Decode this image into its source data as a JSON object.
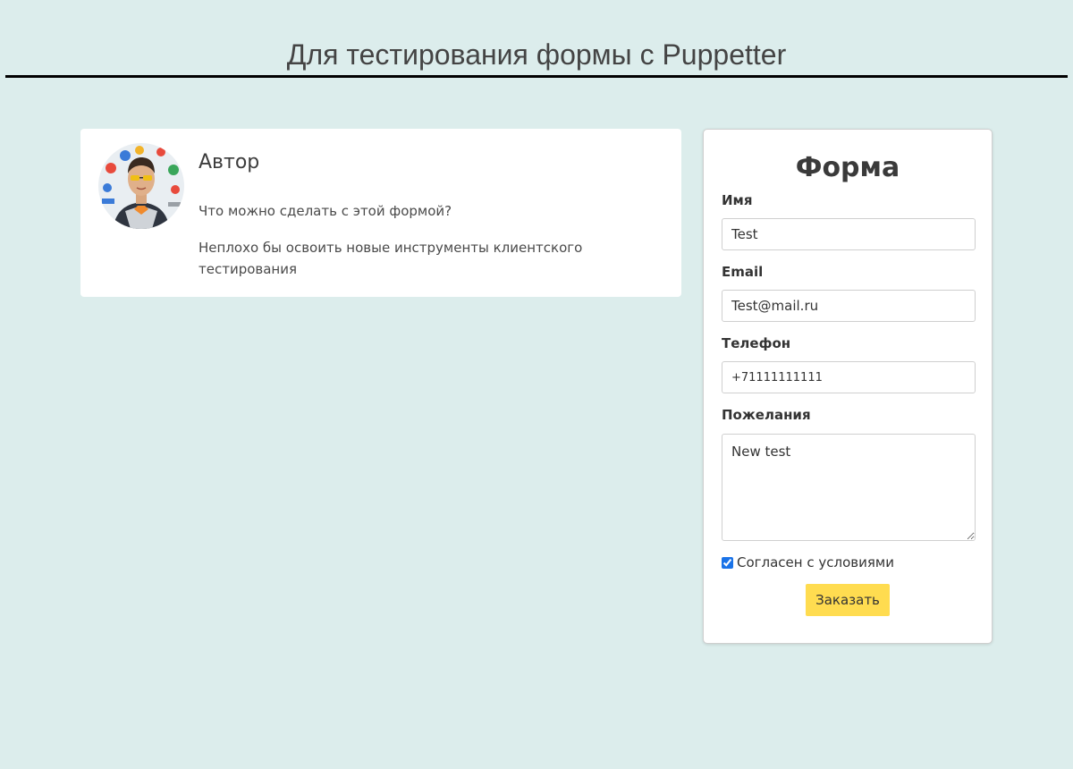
{
  "page": {
    "title": "Для тестирования формы с Puppetter",
    "background": "#dcedec"
  },
  "author": {
    "heading": "Автор",
    "question": "Что можно сделать с этой формой?",
    "text": "Неплохо бы освоить новые инструменты клиентского тестирования",
    "avatar_icon": "author-photo"
  },
  "form": {
    "title": "Форма",
    "name_label": "Имя",
    "name_value": "Test",
    "email_label": "Email",
    "email_value": "Test@mail.ru",
    "phone_label": "Телефон",
    "phone_value": "+71111111111",
    "wishes_label": "Пожелания",
    "wishes_value": "New test",
    "agree_label": "Согласен с условиями",
    "agree_checked": true,
    "submit_label": "Заказать",
    "submit_color": "#ffdc50"
  }
}
